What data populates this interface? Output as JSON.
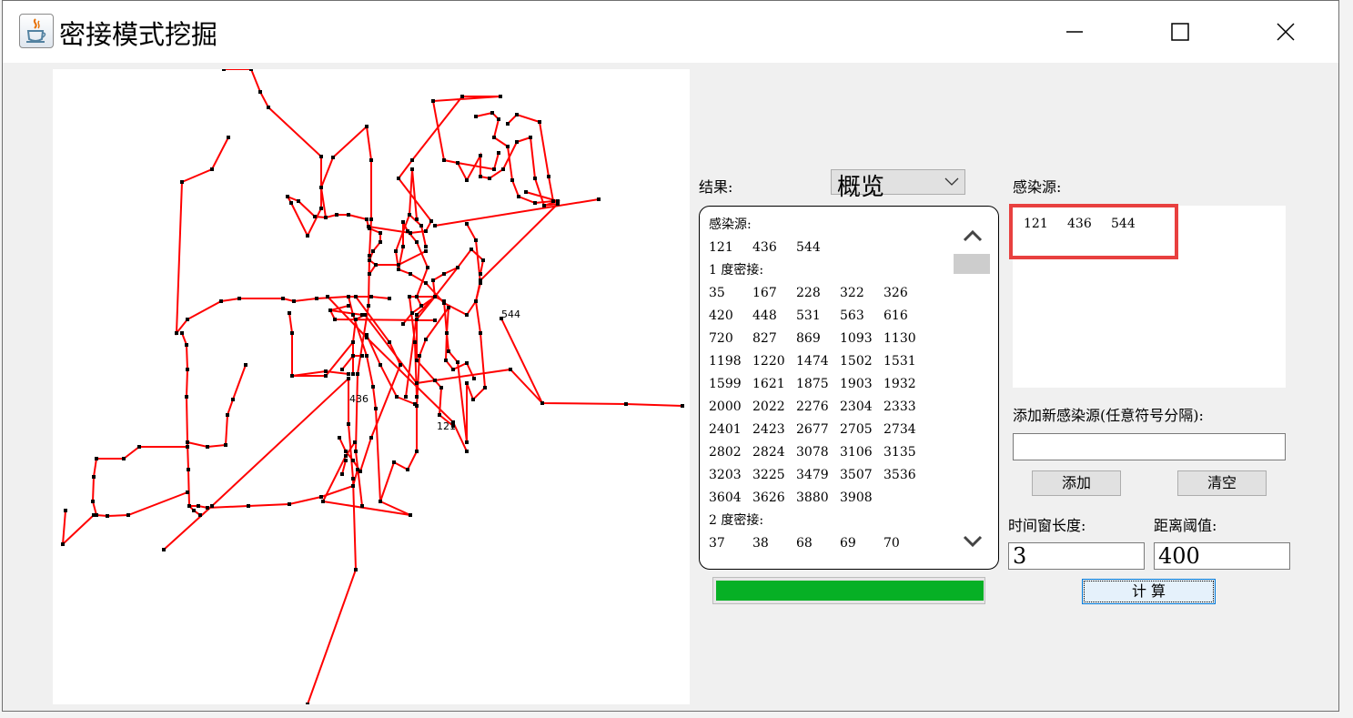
{
  "window": {
    "title": "密接模式挖掘",
    "icon": "java-cup-icon",
    "controls": [
      "minimize-icon",
      "maximize-icon",
      "close-icon"
    ]
  },
  "canvas": {
    "line_color": "#ff0000",
    "node_color": "#000000",
    "node_labels": [
      "544",
      "436",
      "121"
    ]
  },
  "result": {
    "label": "结果:",
    "view_select": "概览",
    "sections": [
      {
        "title": "感染源:",
        "rows": [
          [
            "121",
            "436",
            "544"
          ]
        ]
      },
      {
        "title": "1 度密接:",
        "rows": [
          [
            "35",
            "167",
            "228",
            "322",
            "326"
          ],
          [
            "420",
            "448",
            "531",
            "563",
            "616"
          ],
          [
            "720",
            "827",
            "869",
            "1093",
            "1130"
          ],
          [
            "1198",
            "1220",
            "1474",
            "1502",
            "1531"
          ],
          [
            "1599",
            "1621",
            "1875",
            "1903",
            "1932"
          ],
          [
            "2000",
            "2022",
            "2276",
            "2304",
            "2333"
          ],
          [
            "2401",
            "2423",
            "2677",
            "2705",
            "2734"
          ],
          [
            "2802",
            "2824",
            "3078",
            "3106",
            "3135"
          ],
          [
            "3203",
            "3225",
            "3479",
            "3507",
            "3536"
          ],
          [
            "3604",
            "3626",
            "3880",
            "3908"
          ]
        ]
      },
      {
        "title": "2 度密接:",
        "rows": [
          [
            "37",
            "38",
            "68",
            "69",
            "70"
          ]
        ]
      }
    ]
  },
  "progress": {
    "percent": 100,
    "color": "#06b025"
  },
  "sources": {
    "label": "感染源:",
    "values": [
      "121",
      "436",
      "544"
    ],
    "highlight_color": "#e8403f"
  },
  "add_source": {
    "label": "添加新感染源(任意符号分隔):",
    "value": "",
    "add_button": "添加",
    "clear_button": "清空"
  },
  "params": {
    "time_window_label": "时间窗长度:",
    "time_window_value": "3",
    "distance_label": "距离阈值:",
    "distance_value": "400"
  },
  "calc_button": "计 算"
}
